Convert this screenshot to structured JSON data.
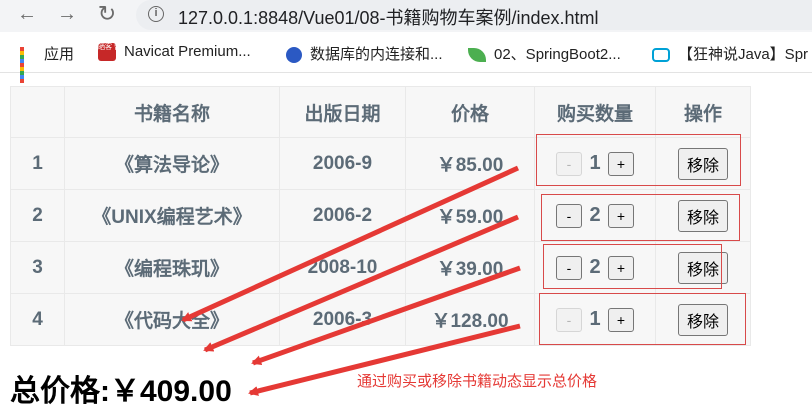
{
  "browser": {
    "back_icon": "←",
    "forward_icon": "→",
    "reload_icon": "↻",
    "info_icon": "i",
    "url": "127.0.0.1:8848/Vue01/08-书籍购物车案例/index.html"
  },
  "bookmarks": [
    {
      "label": "应用",
      "icon": "apps-grid-icon"
    },
    {
      "label": "Navicat Premium...",
      "icon": "navicat-icon",
      "icon_text": "晒客\n留言"
    },
    {
      "label": "数据库的内连接和...",
      "icon": "baidu-paw-icon"
    },
    {
      "label": "02、SpringBoot2...",
      "icon": "leaf-icon"
    },
    {
      "label": "【狂神说Java】Spr",
      "icon": "bilibili-tv-icon"
    }
  ],
  "table": {
    "headers": [
      "",
      "书籍名称",
      "出版日期",
      "价格",
      "购买数量",
      "操作"
    ],
    "rows": [
      {
        "id": "1",
        "name": "《算法导论》",
        "date": "2006-9",
        "price": "￥85.00",
        "qty": "1",
        "minus": "-",
        "plus": "+",
        "remove": "移除",
        "minus_disabled": true
      },
      {
        "id": "2",
        "name": "《UNIX编程艺术》",
        "date": "2006-2",
        "price": "￥59.00",
        "qty": "2",
        "minus": "-",
        "plus": "+",
        "remove": "移除",
        "minus_disabled": false
      },
      {
        "id": "3",
        "name": "《编程珠玑》",
        "date": "2008-10",
        "price": "￥39.00",
        "qty": "2",
        "minus": "-",
        "plus": "+",
        "remove": "移除",
        "minus_disabled": false
      },
      {
        "id": "4",
        "name": "《代码大全》",
        "date": "2006-3",
        "price": "￥128.00",
        "qty": "1",
        "minus": "-",
        "plus": "+",
        "remove": "移除",
        "minus_disabled": true
      }
    ]
  },
  "total": "总价格:￥409.00",
  "annotation": "通过购买或移除书籍动态显示总价格",
  "colors": {
    "accent_red": "#e53935",
    "cell_text": "#5c6b77"
  }
}
